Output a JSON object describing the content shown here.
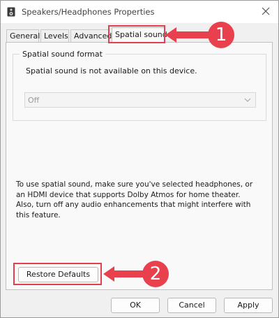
{
  "window": {
    "title": "Speakers/Headphones Properties"
  },
  "tabs": [
    {
      "label": "General"
    },
    {
      "label": "Levels"
    },
    {
      "label": "Advanced"
    },
    {
      "label": "Spatial sound"
    }
  ],
  "spatial": {
    "group_label": "Spatial sound format",
    "status_text": "Spatial sound is not available on this device.",
    "format_value": "Off",
    "info_lines": [
      "To use spatial sound, make sure you've selected headphones, or",
      "an HDMI device that supports Dolby Atmos for home theater.",
      "Also, turn off any audio enhancements that might interfere with",
      "this feature."
    ]
  },
  "buttons": {
    "restore_defaults": "Restore Defaults",
    "ok": "OK",
    "cancel": "Cancel",
    "apply": "Apply"
  },
  "annotations": [
    {
      "number": "1"
    },
    {
      "number": "2"
    }
  ],
  "colors": {
    "annotation": "#e8404d",
    "window_bg": "#f0f0f0"
  },
  "icons": {
    "app": "speaker-icon",
    "close": "close-icon",
    "dropdown": "chevron-down-icon"
  }
}
